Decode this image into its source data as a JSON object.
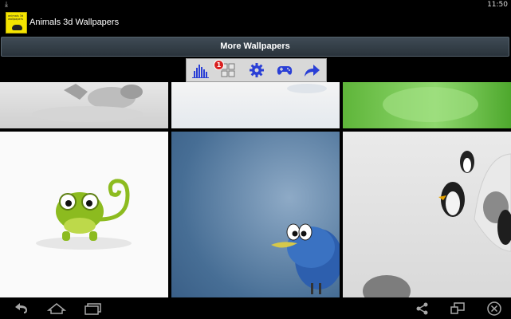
{
  "status_bar": {
    "time": "11:50"
  },
  "app": {
    "title": "Animals 3d Wallpapers",
    "logo_text": "animals 3d wallpapers"
  },
  "banner": {
    "label": "More Wallpapers"
  },
  "toolbar": {
    "notification_count": "1"
  },
  "colors": {
    "toolbar_icon": "#2a3fd6",
    "banner_bg": "#36414a",
    "badge": "#d81f1f"
  }
}
